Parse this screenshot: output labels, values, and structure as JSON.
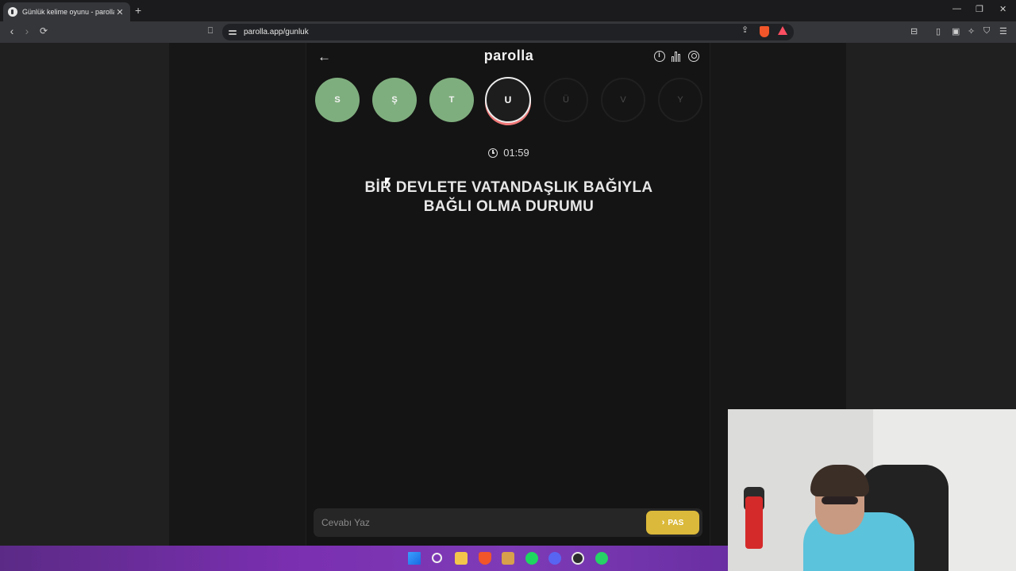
{
  "browser": {
    "tab_title": "Günlük kelime oyunu - parolla -",
    "tab_close": "✕",
    "new_tab": "+",
    "url": "parolla.app/gunluk",
    "window_controls": {
      "minimize": "—",
      "restore": "❐",
      "close": "✕"
    }
  },
  "app": {
    "brand": "parolla",
    "back_icon": "arrow-left-icon",
    "header_icons": [
      "info-icon",
      "stats-icon",
      "user-icon"
    ],
    "letters": [
      {
        "char": "S",
        "state": "done"
      },
      {
        "char": "Ş",
        "state": "done"
      },
      {
        "char": "T",
        "state": "done"
      },
      {
        "char": "U",
        "state": "active"
      },
      {
        "char": "Ü",
        "state": "pending"
      },
      {
        "char": "V",
        "state": "pending"
      },
      {
        "char": "Y",
        "state": "pending"
      }
    ],
    "timer": "01:59",
    "question_line1": "BİR DEVLETE VATANDAŞLIK BAĞIYLA",
    "question_line2": "BAĞLI OLMA DURUMU",
    "answer_placeholder": "Cevabı Yaz",
    "pass_label": "PAS"
  },
  "colors": {
    "done": "#7fae7e",
    "pass": "#dbb93a",
    "active_ring": "#f07878",
    "taskbar": "#7a2fb0"
  },
  "taskbar_icons": [
    "windows-start-icon",
    "search-icon",
    "file-explorer-icon",
    "brave-browser-icon",
    "app-icon",
    "spotify-icon",
    "discord-icon",
    "obs-icon",
    "whatsapp-icon"
  ]
}
